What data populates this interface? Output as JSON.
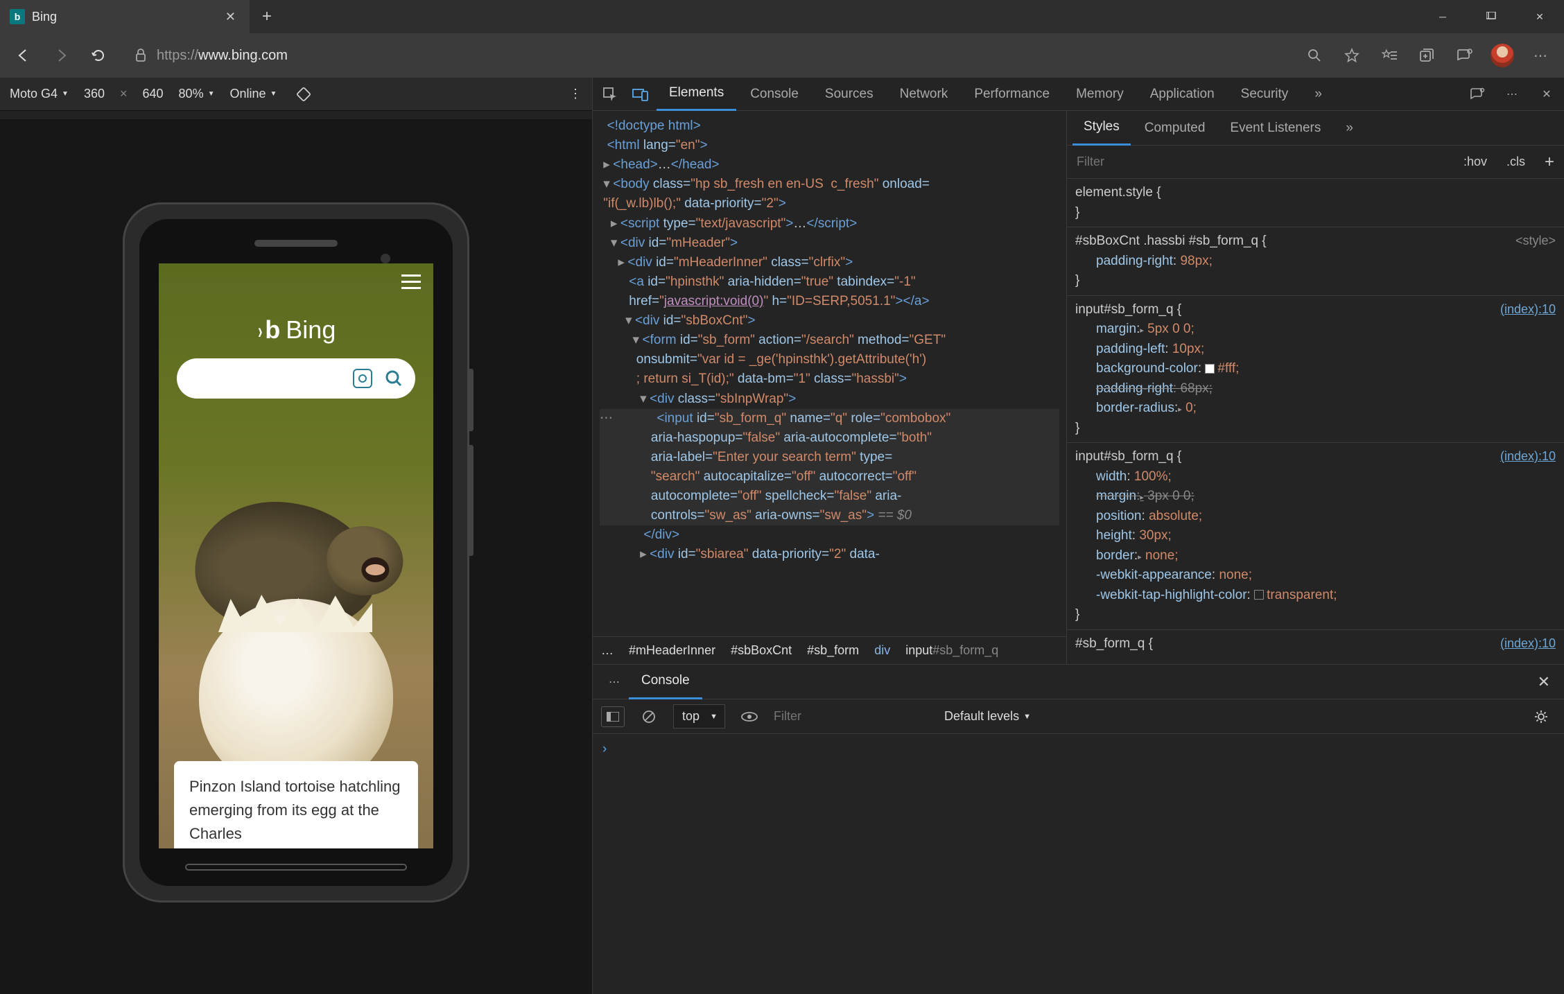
{
  "window": {
    "tab_title": "Bing",
    "url_proto": "https://",
    "url_rest": "www.bing.com"
  },
  "emulation": {
    "device": "Moto G4",
    "width": "360",
    "height": "640",
    "zoom": "80%",
    "throttling": "Online"
  },
  "bing": {
    "brand": "Bing",
    "caption": "Pinzon Island tortoise hatchling emerging from its egg at the Charles"
  },
  "devtools": {
    "tabs": {
      "elements": "Elements",
      "console": "Console",
      "sources": "Sources",
      "network": "Network",
      "performance": "Performance",
      "memory": "Memory",
      "application": "Application",
      "security": "Security"
    },
    "styles_tabs": {
      "styles": "Styles",
      "computed": "Computed",
      "listeners": "Event Listeners"
    },
    "styles_filter_placeholder": "Filter",
    "hov": ":hov",
    "cls": ".cls",
    "breadcrumb": {
      "b0": "…",
      "b1": "#mHeaderInner",
      "b2": "#sbBoxCnt",
      "b3": "#sb_form",
      "b4": "div",
      "b5_prefix": "input",
      "b5_sel": "#sb_form_q"
    },
    "rules": {
      "r0_sel": "element.style {",
      "r0_close": "}",
      "r1_sel": "#sbBoxCnt .hassbi #sb_form_q {",
      "r1_origin": "<style>",
      "r1_p1n": "padding-right",
      "r1_p1v": "98px;",
      "r2_sel": "input#sb_form_q {",
      "r2_origin": "(index):10",
      "r2_p1n": "margin",
      "r2_p1v": "5px 0 0;",
      "r2_p2n": "padding-left",
      "r2_p2v": "10px;",
      "r2_p3n": "background-color",
      "r2_p3v": "#fff;",
      "r2_p4n": "padding-right",
      "r2_p4v": "68px;",
      "r2_p5n": "border-radius",
      "r2_p5v": "0;",
      "r3_sel": "input#sb_form_q {",
      "r3_origin": "(index):10",
      "r3_p1n": "width",
      "r3_p1v": "100%;",
      "r3_p2n": "margin",
      "r3_p2v": "3px 0 0;",
      "r3_p3n": "position",
      "r3_p3v": "absolute;",
      "r3_p4n": "height",
      "r3_p4v": "30px;",
      "r3_p5n": "border",
      "r3_p5v": "none;",
      "r3_p6n": "-webkit-appearance",
      "r3_p6v": "none;",
      "r3_p7n": "-webkit-tap-highlight-color",
      "r3_p7v": "transparent;",
      "r4_sel": "#sb_form_q {",
      "r4_origin": "(index):10"
    },
    "dom": {
      "l0": "<!doctype html>",
      "l1_open": "<html ",
      "l1_a1": "lang=",
      "l1_v1": "\"en\"",
      "l1_close": ">",
      "l2": "<head>…</head>",
      "l3_open": "<body ",
      "l3_a1": "class=",
      "l3_v1": "\"hp sb_fresh en en-US  c_fresh\"",
      "l3_a2": " onload=",
      "l3b": "\"if(_w.lb)lb();\"",
      "l3_a3": " data-priority=",
      "l3_v3": "\"2\"",
      "l3_end": ">",
      "l4_open": "<script ",
      "l4_a1": "type=",
      "l4_v1": "\"text/javascript\"",
      "l4_mid": ">…</script>",
      "l5_open": "<div ",
      "l5_a1": "id=",
      "l5_v1": "\"mHeader\"",
      "l5_end": ">",
      "l6_open": "<div ",
      "l6_a1": "id=",
      "l6_v1": "\"mHeaderInner\"",
      "l6_a2": " class=",
      "l6_v2": "\"clrfix\"",
      "l6_end": ">",
      "l7_open": "<a ",
      "l7_a1": "id=",
      "l7_v1": "\"hpinsthk\"",
      "l7_a2": " aria-hidden=",
      "l7_v2": "\"true\"",
      "l7_a3": " tabindex=",
      "l7_v3": "\"-1\"",
      "l7b_a1": "href=",
      "l7b_v1": "javascript:void(0)",
      "l7b_a2": " h=",
      "l7b_v2": "\"ID=SERP,5051.1\"",
      "l7b_end": "></a>",
      "l8_open": "<div ",
      "l8_a1": "id=",
      "l8_v1": "\"sbBoxCnt\"",
      "l8_end": ">",
      "l9_open": "<form ",
      "l9_a1": "id=",
      "l9_v1": "\"sb_form\"",
      "l9_a2": " action=",
      "l9_v2": "\"/search\"",
      "l9_a3": " method=",
      "l9_v3": "\"GET\"",
      "l9b_a1": "onsubmit=",
      "l9b_v1": "\"var id = _ge('hpinsthk').getAttribute('h')",
      "l9c": "; return si_T(id);\"",
      "l9c_a1": " data-bm=",
      "l9c_v1": "\"1\"",
      "l9c_a2": " class=",
      "l9c_v2": "\"hassbi\"",
      "l9c_end": ">",
      "l10_open": "<div ",
      "l10_a1": "class=",
      "l10_v1": "\"sbInpWrap\"",
      "l10_end": ">",
      "l11_open": "<input ",
      "l11_a1": "id=",
      "l11_v1": "\"sb_form_q\"",
      "l11_a2": " name=",
      "l11_v2": "\"q\"",
      "l11_a3": " role=",
      "l11_v3": "\"combobox\"",
      "l11b_a1": "aria-haspopup=",
      "l11b_v1": "\"false\"",
      "l11b_a2": " aria-autocomplete=",
      "l11b_v2": "\"both\"",
      "l11c_a1": "aria-label=",
      "l11c_v1": "\"Enter your search term\"",
      "l11c_a2": " type=",
      "l11d_v1": "\"search\"",
      "l11d_a1": " autocapitalize=",
      "l11d_v2": "\"off\"",
      "l11d_a2": " autocorrect=",
      "l11d_v3": "\"off\"",
      "l11e_a1": "autocomplete=",
      "l11e_v1": "\"off\"",
      "l11e_a2": " spellcheck=",
      "l11e_v2": "\"false\"",
      "l11e_a3": " aria-",
      "l11f_a1": "controls=",
      "l11f_v1": "\"sw_as\"",
      "l11f_a2": " aria-owns=",
      "l11f_v2": "\"sw_as\"",
      "l11f_end": "> ",
      "l11f_suffix": "== $0",
      "l12": "</div>",
      "l13_open": "<div ",
      "l13_a1": "id=",
      "l13_v1": "\"sbiarea\"",
      "l13_a2": " data-priority=",
      "l13_v2": "\"2\"",
      "l13_a3": " data-"
    },
    "console": {
      "tab": "Console",
      "context": "top",
      "filter_placeholder": "Filter",
      "levels": "Default levels",
      "prompt": "›"
    }
  }
}
